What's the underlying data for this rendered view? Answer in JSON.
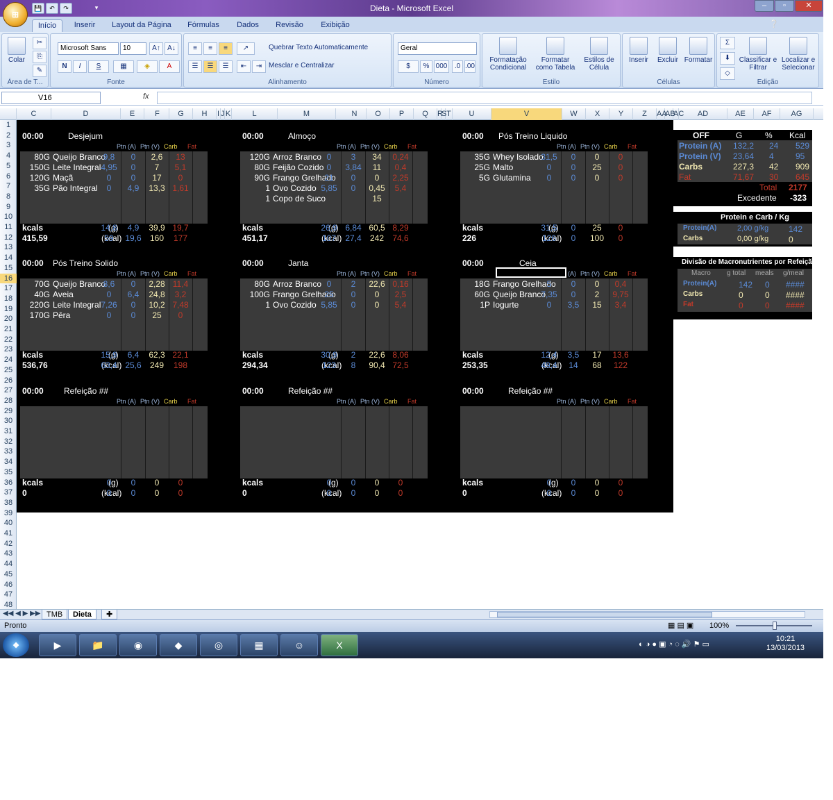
{
  "window": {
    "title": "Dieta - Microsoft Excel",
    "orb": "Office",
    "min": "–",
    "max": "▫",
    "close": "✕"
  },
  "qat": [
    "💾",
    "↶",
    "↷",
    "▾"
  ],
  "tabs": [
    "Início",
    "Inserir",
    "Layout da Página",
    "Fórmulas",
    "Dados",
    "Revisão",
    "Exibição"
  ],
  "ribbon": {
    "clipboard": {
      "label": "Área de T...",
      "paste": "Colar"
    },
    "font": {
      "label": "Fonte",
      "name": "Microsoft Sans",
      "size": "10",
      "bold": "N",
      "italic": "I",
      "underline": "S"
    },
    "align": {
      "label": "Alinhamento",
      "wrap": "Quebrar Texto Automaticamente",
      "merge": "Mesclar e Centralizar"
    },
    "number": {
      "label": "Número",
      "format": "Geral",
      "pct": "%",
      "thousand": "000"
    },
    "styles": {
      "label": "Estilo",
      "cond": "Formatação Condicional",
      "table": "Formatar como Tabela",
      "cell": "Estilos de Célula"
    },
    "cells": {
      "label": "Células",
      "insert": "Inserir",
      "delete": "Excluir",
      "format": "Formatar"
    },
    "edit": {
      "label": "Edição",
      "sort": "Classificar e Filtrar",
      "find": "Localizar e Selecionar"
    }
  },
  "formula_bar": {
    "name_box": "V16",
    "fx": "fx",
    "value": ""
  },
  "columns": [
    "C",
    "D",
    "E",
    "F",
    "G",
    "H",
    "I",
    "J",
    "K",
    "L",
    "M",
    "N",
    "O",
    "P",
    "Q",
    "R",
    "S",
    "T",
    "U",
    "V",
    "W",
    "X",
    "Y",
    "Z",
    "AA",
    "AB",
    "AC",
    "AD",
    "AE",
    "AF",
    "AG"
  ],
  "rows": [
    "1",
    "2",
    "3",
    "4",
    "5",
    "6",
    "7",
    "8",
    "9",
    "10",
    "11",
    "12",
    "13",
    "14",
    "15",
    "16",
    "17",
    "18",
    "19",
    "20",
    "21",
    "22",
    "23",
    "24",
    "25",
    "26",
    "27",
    "28",
    "29",
    "30",
    "31",
    "32",
    "33",
    "34",
    "35",
    "36",
    "37",
    "38",
    "39",
    "40",
    "41",
    "42",
    "43",
    "44",
    "45",
    "46",
    "47",
    "48",
    "49"
  ],
  "col_headers": {
    "pa": "Ptn (A)",
    "pv": "Ptn (V)",
    "carb": "Carb",
    "fat": "Fat"
  },
  "labels": {
    "kcals": "kcals",
    "g": "(g)",
    "kcal": "(kcal)"
  },
  "meals": [
    {
      "time": "00:00",
      "name": "Desjejum",
      "items": [
        {
          "q": "80G",
          "f": "Queijo Branco",
          "a": "9,8",
          "b": "0",
          "c": "2,6",
          "d": "13"
        },
        {
          "q": "150G",
          "f": "Leite Integral",
          "a": "4,95",
          "b": "0",
          "c": "7",
          "d": "5,1"
        },
        {
          "q": "120G",
          "f": "Maçã",
          "a": "0",
          "b": "0",
          "c": "17",
          "d": "0"
        },
        {
          "q": "35G",
          "f": "Pão Integral",
          "a": "0",
          "b": "4,9",
          "c": "13,3",
          "d": "1,61"
        }
      ],
      "tg": {
        "a": "14,8",
        "b": "4,9",
        "c": "39,9",
        "d": "19,7"
      },
      "tk": {
        "a": "59",
        "b": "19,6",
        "c": "160",
        "d": "177"
      },
      "kcals": "415,59"
    },
    {
      "time": "00:00",
      "name": "Almoço",
      "items": [
        {
          "q": "120G",
          "f": "Arroz Branco",
          "a": "0",
          "b": "3",
          "c": "34",
          "d": "0,24"
        },
        {
          "q": "80G",
          "f": "Feijão Cozido",
          "a": "0",
          "b": "3,84",
          "c": "11",
          "d": "0,4"
        },
        {
          "q": "90G",
          "f": "Frango Grelhado",
          "a": "21",
          "b": "0",
          "c": "0",
          "d": "2,25"
        },
        {
          "q": "1",
          "f": "Ovo Cozido",
          "a": "5,85",
          "b": "0",
          "c": "0,45",
          "d": "5,4"
        },
        {
          "q": "1",
          "f": "Copo de Suco",
          "a": "",
          "b": "",
          "c": "15",
          "d": ""
        }
      ],
      "tg": {
        "a": "26,9",
        "b": "6,84",
        "c": "60,5",
        "d": "8,29"
      },
      "tk": {
        "a": "107",
        "b": "27,4",
        "c": "242",
        "d": "74,6"
      },
      "kcals": "451,17"
    },
    {
      "time": "00:00",
      "name": "Pós Treino Liquido",
      "items": [
        {
          "q": "35G",
          "f": "Whey Isolado",
          "a": "31,5",
          "b": "0",
          "c": "0",
          "d": "0"
        },
        {
          "q": "25G",
          "f": "Malto",
          "a": "0",
          "b": "0",
          "c": "25",
          "d": "0"
        },
        {
          "q": "5G",
          "f": "Glutamina",
          "a": "0",
          "b": "0",
          "c": "0",
          "d": "0"
        }
      ],
      "tg": {
        "a": "31,5",
        "b": "0",
        "c": "25",
        "d": "0"
      },
      "tk": {
        "a": "126",
        "b": "0",
        "c": "100",
        "d": "0"
      },
      "kcals": "226"
    },
    {
      "time": "00:00",
      "name": "Pós Treino Solido",
      "items": [
        {
          "q": "70G",
          "f": "Queijo Branco",
          "a": "8,6",
          "b": "0",
          "c": "2,28",
          "d": "11,4"
        },
        {
          "q": "40G",
          "f": "Aveia",
          "a": "0",
          "b": "6,4",
          "c": "24,8",
          "d": "3,2"
        },
        {
          "q": "220G",
          "f": "Leite Integral",
          "a": "7,26",
          "b": "0",
          "c": "10,2",
          "d": "7,48"
        },
        {
          "q": "170G",
          "f": "Pêra",
          "a": "0",
          "b": "0",
          "c": "25",
          "d": "0"
        }
      ],
      "tg": {
        "a": "15,9",
        "b": "6,4",
        "c": "62,3",
        "d": "22,1"
      },
      "tk": {
        "a": "63,4",
        "b": "25,6",
        "c": "249",
        "d": "198"
      },
      "kcals": "536,76"
    },
    {
      "time": "00:00",
      "name": "Janta",
      "items": [
        {
          "q": "80G",
          "f": "Arroz Branco",
          "a": "0",
          "b": "2",
          "c": "22,6",
          "d": "0,16"
        },
        {
          "q": "100G",
          "f": "Frango Grelhado",
          "a": "25",
          "b": "0",
          "c": "0",
          "d": "2,5"
        },
        {
          "q": "1",
          "f": "Ovo Cozido",
          "a": "5,85",
          "b": "0",
          "c": "0",
          "d": "5,4"
        }
      ],
      "tg": {
        "a": "30,9",
        "b": "2",
        "c": "22,6",
        "d": "8,06"
      },
      "tk": {
        "a": "123",
        "b": "8",
        "c": "90,4",
        "d": "72,5"
      },
      "kcals": "294,34"
    },
    {
      "time": "00:00",
      "name": "Ceia",
      "items": [
        {
          "q": "18G",
          "f": "Frango Grelhado",
          "a": "5",
          "b": "0",
          "c": "0",
          "d": "0,4"
        },
        {
          "q": "60G",
          "f": "Queijo Branco",
          "a": "7,35",
          "b": "0",
          "c": "2",
          "d": "9,75"
        },
        {
          "q": "1P",
          "f": "Iogurte",
          "a": "0",
          "b": "3,5",
          "c": "15",
          "d": "3,4"
        }
      ],
      "tg": {
        "a": "12,4",
        "b": "3,5",
        "c": "17",
        "d": "13,6"
      },
      "tk": {
        "a": "49,4",
        "b": "14",
        "c": "68",
        "d": "122"
      },
      "kcals": "253,35"
    },
    {
      "time": "00:00",
      "name": "Refeição ##",
      "items": [],
      "tg": {
        "a": "0",
        "b": "0",
        "c": "0",
        "d": "0"
      },
      "tk": {
        "a": "0",
        "b": "0",
        "c": "0",
        "d": "0"
      },
      "kcals": "0"
    },
    {
      "time": "00:00",
      "name": "Refeição ##",
      "items": [],
      "tg": {
        "a": "0",
        "b": "0",
        "c": "0",
        "d": "0"
      },
      "tk": {
        "a": "0",
        "b": "0",
        "c": "0",
        "d": "0"
      },
      "kcals": "0"
    },
    {
      "time": "00:00",
      "name": "Refeição ##",
      "items": [],
      "tg": {
        "a": "0",
        "b": "0",
        "c": "0",
        "d": "0"
      },
      "tk": {
        "a": "0",
        "b": "0",
        "c": "0",
        "d": "0"
      },
      "kcals": "0"
    }
  ],
  "summary": {
    "off": "OFF",
    "h_g": "G",
    "h_pct": "%",
    "h_kcal": "Kcal",
    "rows": [
      {
        "name": "Protein (A)",
        "g": "132,2",
        "pct": "24",
        "kcal": "529"
      },
      {
        "name": "Protein (V)",
        "g": "23,64",
        "pct": "4",
        "kcal": "95"
      },
      {
        "name": "Carbs",
        "g": "227,3",
        "pct": "42",
        "kcal": "909"
      },
      {
        "name": "Fat",
        "g": "71,67",
        "pct": "30",
        "kcal": "645"
      }
    ],
    "total_label": "Total",
    "total": "2177",
    "exc_label": "Excedente",
    "exc": "-323"
  },
  "per_kg": {
    "title": "Protein e Carb / Kg",
    "rows": [
      {
        "name": "Protein(A)",
        "v": "2,00 g/kg",
        "x": "142"
      },
      {
        "name": "Carbs",
        "v": "0,00 g/kg",
        "x": "0"
      }
    ]
  },
  "division": {
    "title": "Divisão de Macronutrientes por Refeição",
    "h": [
      "Macro",
      "g total",
      "meals",
      "g/meal"
    ],
    "rows": [
      {
        "name": "Protein(A)",
        "g": "142",
        "m": "0",
        "gm": "####"
      },
      {
        "name": "Carbs",
        "g": "0",
        "m": "0",
        "gm": "####"
      },
      {
        "name": "Fat",
        "g": "0",
        "m": "0",
        "gm": "####"
      }
    ]
  },
  "sheet_tabs": [
    "TMB",
    "Dieta"
  ],
  "status": {
    "ready": "Pronto",
    "zoom": "100%"
  },
  "clock": {
    "time": "10:21",
    "date": "13/03/2013"
  }
}
